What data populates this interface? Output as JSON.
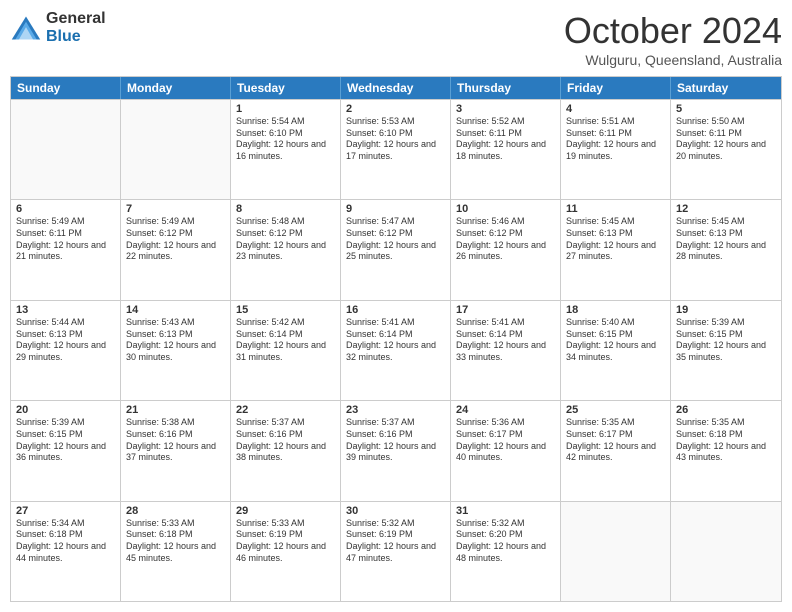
{
  "logo": {
    "general": "General",
    "blue": "Blue"
  },
  "header": {
    "month": "October 2024",
    "location": "Wulguru, Queensland, Australia"
  },
  "days": [
    "Sunday",
    "Monday",
    "Tuesday",
    "Wednesday",
    "Thursday",
    "Friday",
    "Saturday"
  ],
  "weeks": [
    [
      {
        "day": "",
        "empty": true
      },
      {
        "day": "",
        "empty": true
      },
      {
        "day": "1",
        "sunrise": "5:54 AM",
        "sunset": "6:10 PM",
        "daylight": "12 hours and 16 minutes."
      },
      {
        "day": "2",
        "sunrise": "5:53 AM",
        "sunset": "6:10 PM",
        "daylight": "12 hours and 17 minutes."
      },
      {
        "day": "3",
        "sunrise": "5:52 AM",
        "sunset": "6:11 PM",
        "daylight": "12 hours and 18 minutes."
      },
      {
        "day": "4",
        "sunrise": "5:51 AM",
        "sunset": "6:11 PM",
        "daylight": "12 hours and 19 minutes."
      },
      {
        "day": "5",
        "sunrise": "5:50 AM",
        "sunset": "6:11 PM",
        "daylight": "12 hours and 20 minutes."
      }
    ],
    [
      {
        "day": "6",
        "sunrise": "5:49 AM",
        "sunset": "6:11 PM",
        "daylight": "12 hours and 21 minutes."
      },
      {
        "day": "7",
        "sunrise": "5:49 AM",
        "sunset": "6:12 PM",
        "daylight": "12 hours and 22 minutes."
      },
      {
        "day": "8",
        "sunrise": "5:48 AM",
        "sunset": "6:12 PM",
        "daylight": "12 hours and 23 minutes."
      },
      {
        "day": "9",
        "sunrise": "5:47 AM",
        "sunset": "6:12 PM",
        "daylight": "12 hours and 25 minutes."
      },
      {
        "day": "10",
        "sunrise": "5:46 AM",
        "sunset": "6:12 PM",
        "daylight": "12 hours and 26 minutes."
      },
      {
        "day": "11",
        "sunrise": "5:45 AM",
        "sunset": "6:13 PM",
        "daylight": "12 hours and 27 minutes."
      },
      {
        "day": "12",
        "sunrise": "5:45 AM",
        "sunset": "6:13 PM",
        "daylight": "12 hours and 28 minutes."
      }
    ],
    [
      {
        "day": "13",
        "sunrise": "5:44 AM",
        "sunset": "6:13 PM",
        "daylight": "12 hours and 29 minutes."
      },
      {
        "day": "14",
        "sunrise": "5:43 AM",
        "sunset": "6:13 PM",
        "daylight": "12 hours and 30 minutes."
      },
      {
        "day": "15",
        "sunrise": "5:42 AM",
        "sunset": "6:14 PM",
        "daylight": "12 hours and 31 minutes."
      },
      {
        "day": "16",
        "sunrise": "5:41 AM",
        "sunset": "6:14 PM",
        "daylight": "12 hours and 32 minutes."
      },
      {
        "day": "17",
        "sunrise": "5:41 AM",
        "sunset": "6:14 PM",
        "daylight": "12 hours and 33 minutes."
      },
      {
        "day": "18",
        "sunrise": "5:40 AM",
        "sunset": "6:15 PM",
        "daylight": "12 hours and 34 minutes."
      },
      {
        "day": "19",
        "sunrise": "5:39 AM",
        "sunset": "6:15 PM",
        "daylight": "12 hours and 35 minutes."
      }
    ],
    [
      {
        "day": "20",
        "sunrise": "5:39 AM",
        "sunset": "6:15 PM",
        "daylight": "12 hours and 36 minutes."
      },
      {
        "day": "21",
        "sunrise": "5:38 AM",
        "sunset": "6:16 PM",
        "daylight": "12 hours and 37 minutes."
      },
      {
        "day": "22",
        "sunrise": "5:37 AM",
        "sunset": "6:16 PM",
        "daylight": "12 hours and 38 minutes."
      },
      {
        "day": "23",
        "sunrise": "5:37 AM",
        "sunset": "6:16 PM",
        "daylight": "12 hours and 39 minutes."
      },
      {
        "day": "24",
        "sunrise": "5:36 AM",
        "sunset": "6:17 PM",
        "daylight": "12 hours and 40 minutes."
      },
      {
        "day": "25",
        "sunrise": "5:35 AM",
        "sunset": "6:17 PM",
        "daylight": "12 hours and 42 minutes."
      },
      {
        "day": "26",
        "sunrise": "5:35 AM",
        "sunset": "6:18 PM",
        "daylight": "12 hours and 43 minutes."
      }
    ],
    [
      {
        "day": "27",
        "sunrise": "5:34 AM",
        "sunset": "6:18 PM",
        "daylight": "12 hours and 44 minutes."
      },
      {
        "day": "28",
        "sunrise": "5:33 AM",
        "sunset": "6:18 PM",
        "daylight": "12 hours and 45 minutes."
      },
      {
        "day": "29",
        "sunrise": "5:33 AM",
        "sunset": "6:19 PM",
        "daylight": "12 hours and 46 minutes."
      },
      {
        "day": "30",
        "sunrise": "5:32 AM",
        "sunset": "6:19 PM",
        "daylight": "12 hours and 47 minutes."
      },
      {
        "day": "31",
        "sunrise": "5:32 AM",
        "sunset": "6:20 PM",
        "daylight": "12 hours and 48 minutes."
      },
      {
        "day": "",
        "empty": true
      },
      {
        "day": "",
        "empty": true
      }
    ]
  ]
}
